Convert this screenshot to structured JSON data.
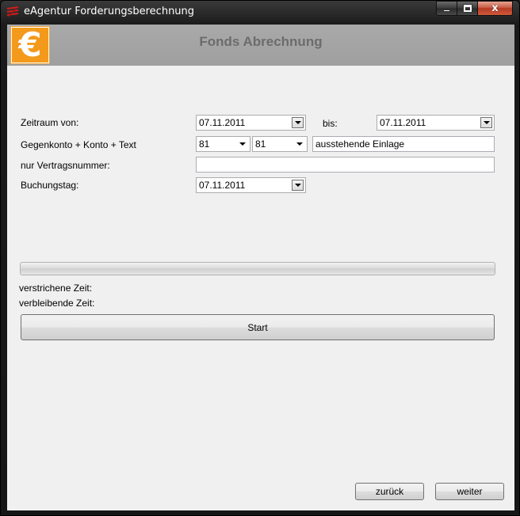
{
  "window": {
    "title": "eAgentur Forderungsberechnung",
    "caption_close": "x"
  },
  "header": {
    "logo_symbol": "€",
    "title": "Fonds Abrechnung",
    "logo_color": "#f39a1d"
  },
  "form": {
    "zeitraum_label": "Zeitraum von:",
    "from_date": "07.11.2011",
    "bis_label": "bis:",
    "to_date": "07.11.2011",
    "gegenkonto_label": "Gegenkonto + Konto + Text",
    "gegenkonto_value": "81",
    "konto_value": "81",
    "text_value": "ausstehende Einlage",
    "vertragsnummer_label": "nur Vertragsnummer:",
    "vertragsnummer_value": "",
    "buchungstag_label": "Buchungstag:",
    "buchungstag_value": "07.11.2011"
  },
  "progress": {
    "value": 0,
    "elapsed_label": "verstrichene Zeit:",
    "remaining_label": "verbleibende Zeit:"
  },
  "buttons": {
    "start": "Start",
    "back": "zurück",
    "next": "weiter"
  }
}
